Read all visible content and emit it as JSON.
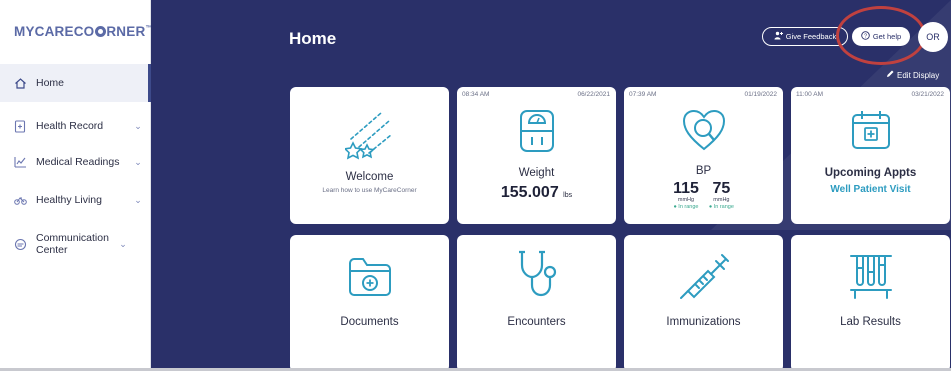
{
  "brand": {
    "logo_part1": "MYCARECO",
    "logo_part2": "RNER",
    "trademark": "™"
  },
  "sidebar": {
    "items": [
      {
        "label": "Home",
        "icon": "home-icon"
      },
      {
        "label": "Health Record",
        "icon": "health-record-icon"
      },
      {
        "label": "Medical Readings",
        "icon": "medical-readings-icon"
      },
      {
        "label": "Healthy Living",
        "icon": "healthy-living-icon"
      },
      {
        "label": "Communication Center",
        "icon": "communication-center-icon"
      }
    ]
  },
  "header": {
    "title": "Home",
    "feedback_label": "Give Feedback",
    "help_label": "Get help",
    "avatar_initials": "OR",
    "edit_display_label": "Edit Display"
  },
  "tiles": {
    "welcome": {
      "title": "Welcome",
      "subtitle": "Learn how to use MyCareCorner"
    },
    "weight": {
      "time": "08:34 AM",
      "date": "06/22/2021",
      "title": "Weight",
      "value": "155.007",
      "unit": "lbs"
    },
    "bp": {
      "time": "07:39 AM",
      "date": "01/19/2022",
      "title": "BP",
      "systolic": "115",
      "diastolic": "75",
      "unit": "mmHg",
      "status": "In range"
    },
    "appts": {
      "time": "11:00 AM",
      "date": "03/21/2022",
      "title": "Upcoming Appts",
      "link": "Well Patient Visit"
    },
    "documents": {
      "title": "Documents"
    },
    "encounters": {
      "title": "Encounters"
    },
    "immunizations": {
      "title": "Immunizations"
    },
    "lab_results": {
      "title": "Lab Results"
    }
  },
  "colors": {
    "panel": "#2a3069",
    "accent": "#2d9cc0",
    "highlight_ring": "#c0413f",
    "brand": "#5b6aa6"
  }
}
